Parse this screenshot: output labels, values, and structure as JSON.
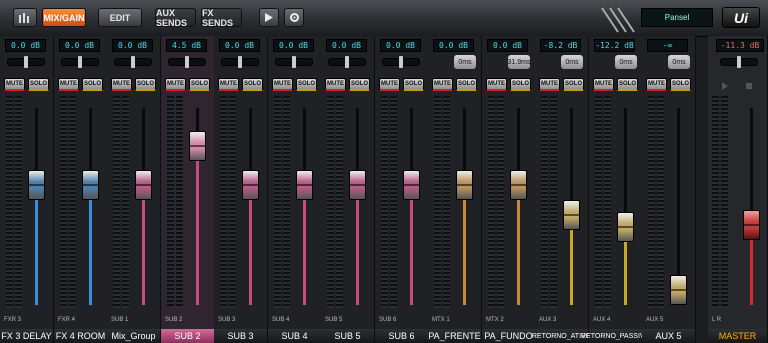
{
  "toolbar": {
    "mix_gain": "MIX/GAIN",
    "edit": "EDIT",
    "aux_sends": "AUX SENDS",
    "fx_sends": "FX SENDS",
    "preset": "Pansel",
    "logo": "Ui"
  },
  "strips": [
    {
      "gain": "0.0 dB",
      "mute": "MUTE",
      "solo": "SOLO",
      "code": "FXR 3",
      "name": "FX 3 DELAY",
      "level": 0.63,
      "accent": "#3b8fd6",
      "cap": "#4d7ea8"
    },
    {
      "gain": "0.0 dB",
      "mute": "MUTE",
      "solo": "SOLO",
      "code": "FXR 4",
      "name": "FX 4 ROOM",
      "level": 0.63,
      "accent": "#3b8fd6",
      "cap": "#4d7ea8"
    },
    {
      "gain": "0.0 dB",
      "mute": "MUTE",
      "solo": "SOLO",
      "code": "SUB 1",
      "name": "Mix_Group",
      "level": 0.63,
      "accent": "#c94b82",
      "cap": "#b75c86"
    },
    {
      "gain": "4.5 dB",
      "mute": "MUTE",
      "solo": "SOLO",
      "code": "SUB 2",
      "name": "SUB 2",
      "level": 0.86,
      "accent": "#c94b82",
      "cap": "#d08aa8",
      "selected": true
    },
    {
      "gain": "0.0 dB",
      "mute": "MUTE",
      "solo": "SOLO",
      "code": "SUB 3",
      "name": "SUB 3",
      "level": 0.63,
      "accent": "#c94b82",
      "cap": "#b75c86"
    },
    {
      "gain": "0.0 dB",
      "mute": "MUTE",
      "solo": "SOLO",
      "code": "SUB 4",
      "name": "SUB 4",
      "level": 0.63,
      "accent": "#c94b82",
      "cap": "#b75c86"
    },
    {
      "gain": "0.0 dB",
      "mute": "MUTE",
      "solo": "SOLO",
      "code": "SUB 5",
      "name": "SUB 5",
      "level": 0.63,
      "accent": "#c94b82",
      "cap": "#b75c86"
    },
    {
      "gain": "0.0 dB",
      "mute": "MUTE",
      "solo": "SOLO",
      "code": "SUB 6",
      "name": "SUB 6",
      "level": 0.63,
      "accent": "#c94b82",
      "cap": "#b75c86"
    },
    {
      "gain": "0.0 dB",
      "delay": "0ms",
      "mute": "MUTE",
      "solo": "SOLO",
      "code": "MTX 1",
      "name": "PA_FRENTE",
      "level": 0.63,
      "accent": "#c88a3a",
      "cap": "#b9935e"
    },
    {
      "gain": "0.0 dB",
      "delay": "31.9ms",
      "mute": "MUTE",
      "solo": "SOLO",
      "code": "MTX 2",
      "name": "PA_FUNDO",
      "level": 0.63,
      "accent": "#c88a3a",
      "cap": "#b9935e"
    },
    {
      "gain": "-8.2 dB",
      "delay": "0ms",
      "mute": "MUTE",
      "solo": "SOLO",
      "code": "AUX 3",
      "name": "RETORNO_ATIVO",
      "level": 0.45,
      "accent": "#c8a824",
      "cap": "#bfa866"
    },
    {
      "gain": "-12.2 dB",
      "delay": "0ms",
      "mute": "MUTE",
      "solo": "SOLO",
      "code": "AUX 4",
      "name": "RETORNO_PASSIVO",
      "level": 0.38,
      "accent": "#c8a824",
      "cap": "#bfa866"
    },
    {
      "gain": "-∞",
      "delay": "0ms",
      "mute": "MUTE",
      "solo": "SOLO",
      "code": "AUX 5",
      "name": "AUX 5",
      "level": 0.0,
      "accent": "#c8a824",
      "cap": "#bfa866"
    }
  ],
  "master": {
    "gain": "-11.3 dB",
    "code": "L R",
    "name": "MASTER",
    "level": 0.39,
    "accent": "#d62b2b",
    "cap": "#c83a3a"
  }
}
